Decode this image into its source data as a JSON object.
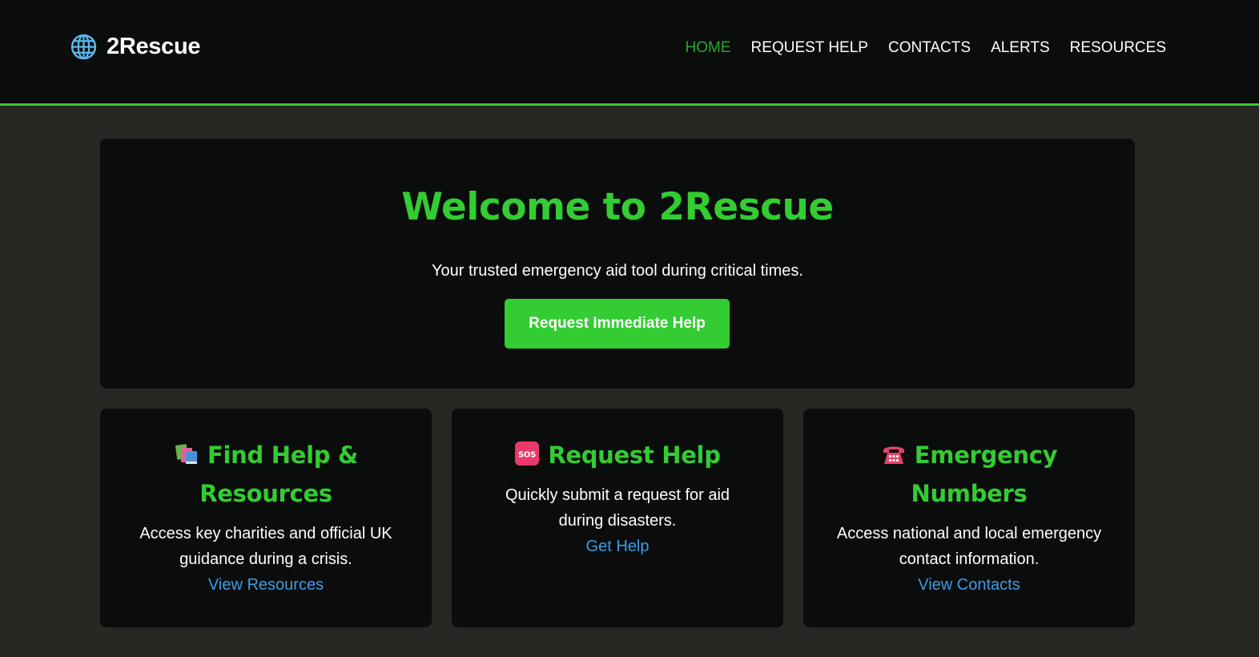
{
  "brand": {
    "name": "2Rescue",
    "icon": "globe-icon"
  },
  "nav": {
    "items": [
      {
        "label": "HOME",
        "active": true
      },
      {
        "label": "REQUEST HELP",
        "active": false
      },
      {
        "label": "CONTACTS",
        "active": false
      },
      {
        "label": "ALERTS",
        "active": false
      },
      {
        "label": "RESOURCES",
        "active": false
      }
    ]
  },
  "hero": {
    "title": "Welcome to 2Rescue",
    "subtitle": "Your trusted emergency aid tool during critical times.",
    "button_label": "Request Immediate Help"
  },
  "cards": [
    {
      "icon": "books-icon",
      "title": "Find Help & Resources",
      "description": "Access key charities and official UK guidance during a crisis.",
      "link_label": "View Resources"
    },
    {
      "icon": "sos-icon",
      "title": "Request Help",
      "description": "Quickly submit a request for aid during disasters.",
      "link_label": "Get Help"
    },
    {
      "icon": "telephone-icon",
      "title": "Emergency Numbers",
      "description": "Access national and local emergency contact information.",
      "link_label": "View Contacts"
    }
  ],
  "colors": {
    "accent": "#33cc33",
    "active_nav": "#2ea52e",
    "link": "#3d9be9",
    "panel": "#0a0d0b",
    "background": "#262824"
  }
}
